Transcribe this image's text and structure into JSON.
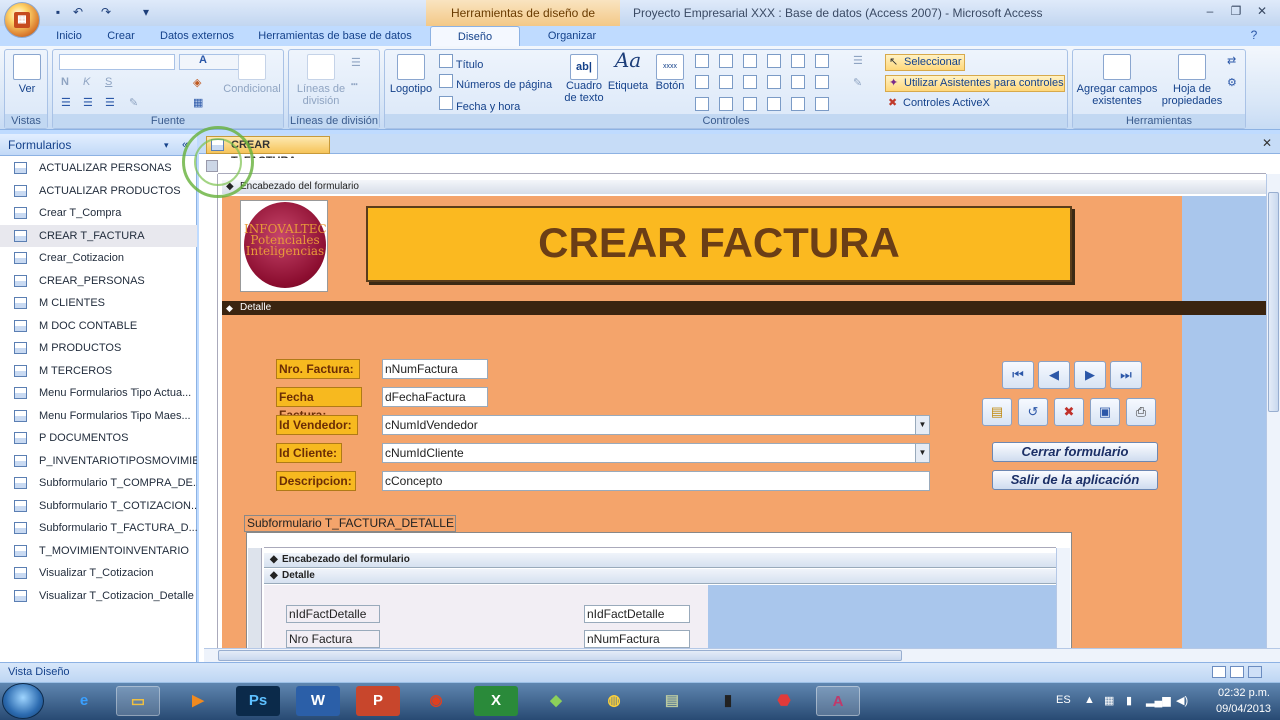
{
  "window": {
    "context_tab": "Herramientas de diseño de formulario",
    "title": "Proyecto Empresarial XXX : Base de datos (Access 2007) - Microsoft Access"
  },
  "tabs": [
    "Inicio",
    "Crear",
    "Datos externos",
    "Herramientas de base de datos",
    "Diseño",
    "Organizar"
  ],
  "ribbon": {
    "vistas": {
      "label": "Vistas",
      "ver": "Ver"
    },
    "fuente": {
      "label": "Fuente",
      "condicional": "Condicional"
    },
    "division": {
      "label": "Líneas de división",
      "lineas": "Líneas de división"
    },
    "controles": {
      "label": "Controles",
      "logotipo": "Logotipo",
      "titulo": "Título",
      "numeros": "Números de página",
      "fecha": "Fecha y hora",
      "cuadro": "Cuadro de texto",
      "etiqueta": "Etiqueta",
      "boton": "Botón",
      "seleccionar": "Seleccionar",
      "asistentes": "Utilizar Asistentes para controles",
      "activex": "Controles ActiveX"
    },
    "herramientas": {
      "label": "Herramientas",
      "agregar": "Agregar campos existentes",
      "hoja": "Hoja de propiedades"
    }
  },
  "nav": {
    "header": "Formularios",
    "items": [
      "ACTUALIZAR PERSONAS",
      "ACTUALIZAR PRODUCTOS",
      "Crear T_Compra",
      "CREAR T_FACTURA",
      "Crear_Cotizacion",
      "CREAR_PERSONAS",
      "M CLIENTES",
      "M DOC CONTABLE",
      "M PRODUCTOS",
      "M TERCEROS",
      "Menu Formularios Tipo Actua...",
      "Menu Formularios Tipo Maes...",
      "P DOCUMENTOS",
      "P_INVENTARIOTIPOSMOVIMIE...",
      "Subformulario T_COMPRA_DE...",
      "Subformulario T_COTIZACION...",
      "Subformulario T_FACTURA_D...",
      "T_MOVIMIENTOINVENTARIO",
      "Visualizar T_Cotizacion",
      "Visualizar T_Cotizacion_Detalle"
    ],
    "selected_index": 3
  },
  "document": {
    "tab": "CREAR T_FACTURA",
    "header_section": "Encabezado del formulario",
    "detail_section": "Detalle",
    "logo_text": "INFOVALTEC Potenciales Inteligencias",
    "form_title": "CREAR FACTURA",
    "fields": [
      {
        "label": "Nro. Factura:",
        "value": "nNumFactura"
      },
      {
        "label": "Fecha Factura:",
        "value": "dFechaFactura"
      },
      {
        "label": "Id Vendedor:",
        "value": "cNumIdVendedor"
      },
      {
        "label": "Id Cliente:",
        "value": "cNumIdCliente"
      },
      {
        "label": "Descripcion:",
        "value": "cConcepto"
      }
    ],
    "cerrar": "Cerrar formulario",
    "salir": "Salir de la aplicación",
    "subform": {
      "label": "Subformulario T_FACTURA_DETALLE",
      "header_section": "Encabezado del formulario",
      "detail_section": "Detalle",
      "label1": "nIdFactDetalle",
      "field1": "nIdFactDetalle",
      "label2": "Nro Factura",
      "field2": "nNumFactura"
    }
  },
  "status": "Vista Diseño",
  "tray": {
    "lang": "ES",
    "time": "02:32 p.m.",
    "date": "09/04/2013"
  },
  "colors": {
    "form_bg": "#f4a46b",
    "title_bg": "#fbb920",
    "label_bg": "#f7b91f",
    "section_bar": "#3a2410"
  }
}
